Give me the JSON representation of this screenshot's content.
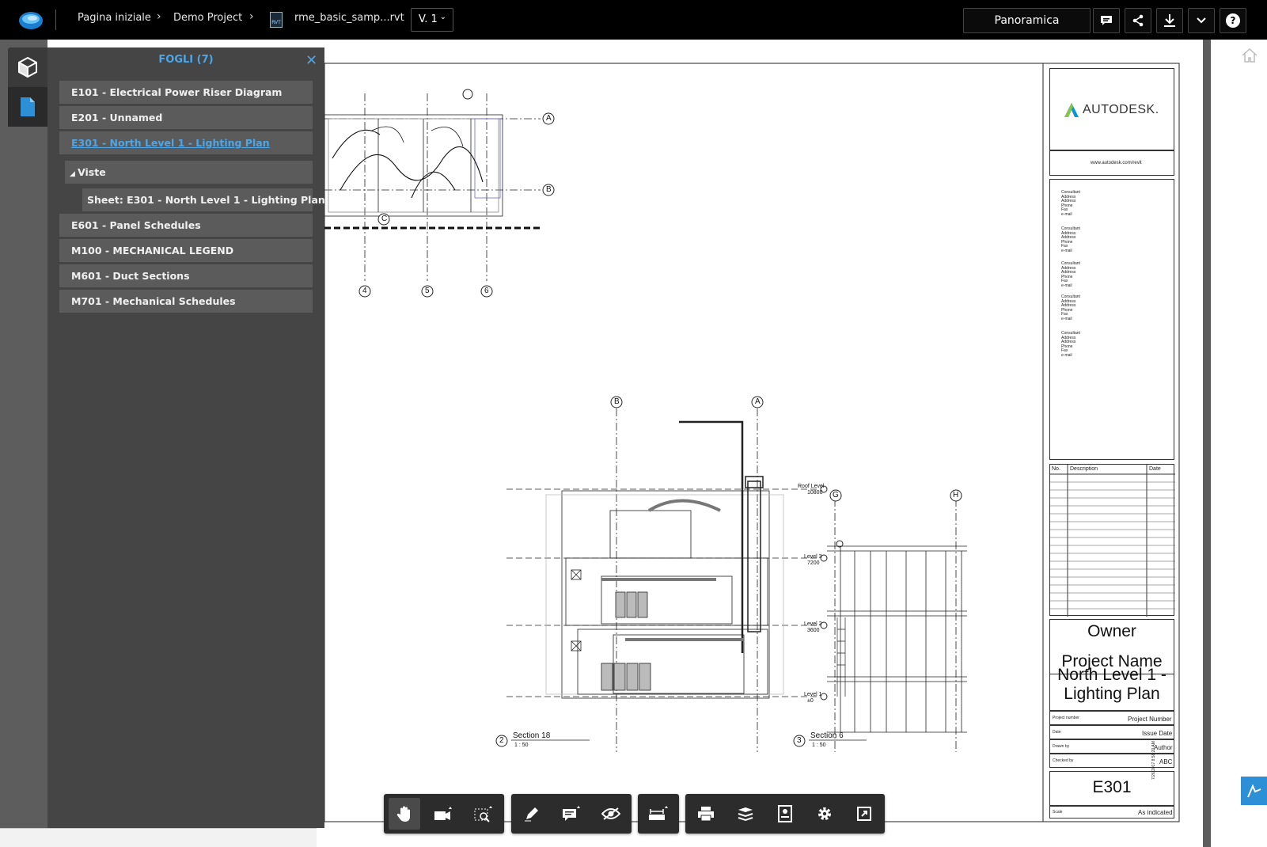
{
  "topbar": {
    "breadcrumbs": [
      "Pagina iniziale",
      "Demo Project",
      "rme_basic_samp...rvt"
    ],
    "file_type_badge": "RVT",
    "version": "V. 1",
    "view_mode_button": "Panoramica",
    "icons": [
      "comment-icon",
      "share-icon",
      "download-icon",
      "chevron-down-icon",
      "help-icon"
    ]
  },
  "rail": {
    "items": [
      "model-3d-icon",
      "sheets-icon"
    ],
    "active": "sheets-icon"
  },
  "panel": {
    "title": "FOGLI (7)",
    "items": [
      {
        "label": "E101 - Electrical Power Riser Diagram"
      },
      {
        "label": "E201 - Unnamed"
      },
      {
        "label": "E301 - North Level 1 - Lighting Plan",
        "active": true
      },
      {
        "label": "Viste",
        "group": true
      },
      {
        "label": "Sheet: E301 - North Level 1 - Lighting Plan"
      },
      {
        "label": "E601 - Panel Schedules"
      },
      {
        "label": "M100 - MECHANICAL LEGEND"
      },
      {
        "label": "M601 - Duct Sections"
      },
      {
        "label": "M701 - Mechanical Schedules"
      }
    ]
  },
  "drawing": {
    "grid_top": [
      "A",
      "B",
      "C",
      "4",
      "5",
      "6"
    ],
    "ghost_label": "North Level 1 Lighting Plan",
    "section_a": {
      "number": "2",
      "title": "Section 18",
      "scale": "1 : 50",
      "grids": [
        "B",
        "A"
      ]
    },
    "section_b": {
      "number": "3",
      "title": "Section 6",
      "scale": "1 : 50",
      "grids": [
        "G",
        "H"
      ]
    },
    "levels": [
      "Roof Level",
      "10800",
      "Level 3",
      "7200",
      "Level 2",
      "3600",
      "Level 1",
      "±0"
    ]
  },
  "titleblock": {
    "brand": "AUTODESK.",
    "url": "www.autodesk.com/revit",
    "consultants": [
      [
        "Consultant",
        "Address",
        "Address",
        "Phone",
        "Fax",
        "e-mail"
      ],
      [
        "Consultant",
        "Address",
        "Address",
        "Phone",
        "Fax",
        "e-mail"
      ],
      [
        "Consultant",
        "Address",
        "Address",
        "Phone",
        "Fax",
        "e-mail"
      ],
      [
        "Consultant",
        "Address",
        "Address",
        "Phone",
        "Fax",
        "e-mail"
      ],
      [
        "Consultant",
        "Address",
        "Address",
        "Phone",
        "Fax",
        "e-mail"
      ]
    ],
    "rev_headers": [
      "No.",
      "Description",
      "Date"
    ],
    "owner": "Owner",
    "project_name": "Project Name",
    "sheet_title": "North Level 1 - Lighting Plan",
    "fields": [
      {
        "label": "Project number",
        "value": "Project Number"
      },
      {
        "label": "Date",
        "value": "Issue Date"
      },
      {
        "label": "Drawn by",
        "value": "Author"
      },
      {
        "label": "Checked by",
        "value": "ABC"
      }
    ],
    "sheet_number": "E301",
    "scale_label": "Scale",
    "scale_value": "As indicated",
    "timestamp": "7/26/2017 8:58:20 AM"
  },
  "toolbar": {
    "groups": [
      [
        "pan-hand-icon",
        "camera-icon",
        "zoom-window-icon"
      ],
      [
        "markup-pen-icon",
        "comment-icon",
        "hide-eye-icon"
      ],
      [
        "measure-icon"
      ],
      [
        "print-icon",
        "layers-icon",
        "properties-icon",
        "settings-gear-icon",
        "fullscreen-icon"
      ]
    ],
    "active": "pan-hand-icon"
  },
  "colors": {
    "accent": "#4da6e8",
    "topbar": "#000000",
    "panel": "#373737",
    "badge": "#2d8fd5"
  }
}
